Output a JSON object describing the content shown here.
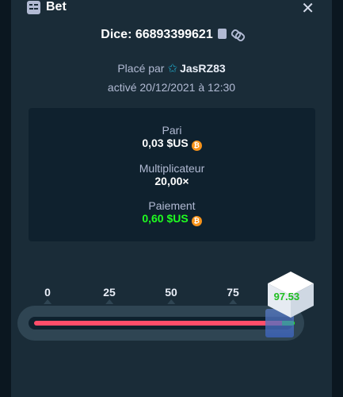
{
  "header": {
    "title": "Bet",
    "close_label": "✕"
  },
  "bet": {
    "id_text": "Dice: 66893399621",
    "placed_by_prefix": "Placé par",
    "username": "JasRZ83",
    "activated_text": "activé 20/12/2021 à 12:30"
  },
  "stats": {
    "bet_label": "Pari",
    "bet_value": "0,03 $US",
    "multiplier_label": "Multiplicateur",
    "multiplier_value": "20,00×",
    "payout_label": "Paiement",
    "payout_value": "0,60 $US",
    "currency_symbol": "₿"
  },
  "dice": {
    "scale_ticks": [
      "0",
      "25",
      "50",
      "75"
    ],
    "result": "97.53",
    "result_value": 97.53,
    "target_value": 95,
    "colors": {
      "lose": "#ff4d6a",
      "win": "#1fff20"
    }
  }
}
